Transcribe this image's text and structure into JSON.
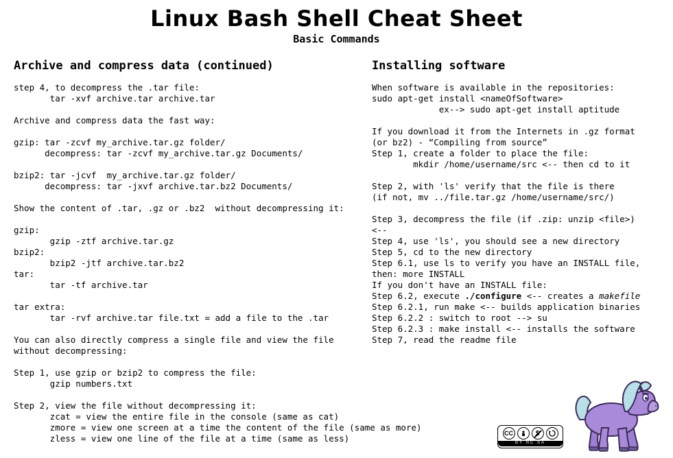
{
  "title": "Linux Bash Shell Cheat Sheet",
  "subtitle": "Basic Commands",
  "left": {
    "heading": "Archive and compress data (continued)",
    "para1": "step 4, to decompress the .tar file:\n       tar -xvf archive.tar archive.tar",
    "para2": "Archive and compress data the fast way:",
    "para3": "gzip: tar -zcvf my_archive.tar.gz folder/\n      decompress: tar -zcvf my_archive.tar.gz Documents/",
    "para4": "bzip2: tar -jcvf  my_archive.tar.gz folder/\n      decompress: tar -jxvf archive.tar.bz2 Documents/",
    "para5": "Show the content of .tar, .gz or .bz2  without decompressing it:",
    "para6": "gzip:\n       gzip -ztf archive.tar.gz\nbzip2:\n       bzip2 -jtf archive.tar.bz2\ntar:\n       tar -tf archive.tar",
    "para7": "tar extra:\n       tar -rvf archive.tar file.txt = add a file to the .tar",
    "para8": "You can also directly compress a single file and view the file\nwithout decompressing:",
    "para9": "Step 1, use gzip or bzip2 to compress the file:\n       gzip numbers.txt",
    "para10": "Step 2, view the file without decompressing it:\n       zcat = view the entire file in the console (same as cat)\n       zmore = view one screen at a time the content of the file (same as more)\n       zless = view one line of the file at a time (same as less)"
  },
  "right": {
    "heading": "Installing software",
    "para1": "When software is available in the repositories:\nsudo apt-get install <nameOfSoftware>\n             ex--> sudo apt-get install aptitude",
    "para2": "If you download it from the Internets in .gz format\n(or bz2) - “Compiling from source”\nStep 1, create a folder to place the file:\n        mkdir /home/username/src <-- then cd to it",
    "para3": "Step 2, with 'ls' verify that the file is there\n(if not, mv ../file.tar.gz /home/username/src/)",
    "para4": "Step 3, decompress the file (if .zip: unzip <file>)\n<--\nStep 4, use 'ls', you should see a new directory\nStep 5, cd to the new directory\nStep 6.1, use ls to verify you have an INSTALL file,\nthen: more INSTALL\nIf you don't have an INSTALL file:",
    "para5_pre": "Step 6.2, execute ",
    "para5_bold": "./configure",
    "para5_post": " <-- creates a ",
    "para5_italic": "makefile",
    "para6": "Step 6.2.1, run make <-- builds application binaries\nStep 6.2.2 : switch to root --> su\nStep 6.2.3 : make install <-- installs the software\nStep 7, read the readme file"
  },
  "cc": {
    "cc": "CC",
    "by": "①",
    "nc": "$",
    "sa": "⟲",
    "label": "BY  NC  SA"
  }
}
